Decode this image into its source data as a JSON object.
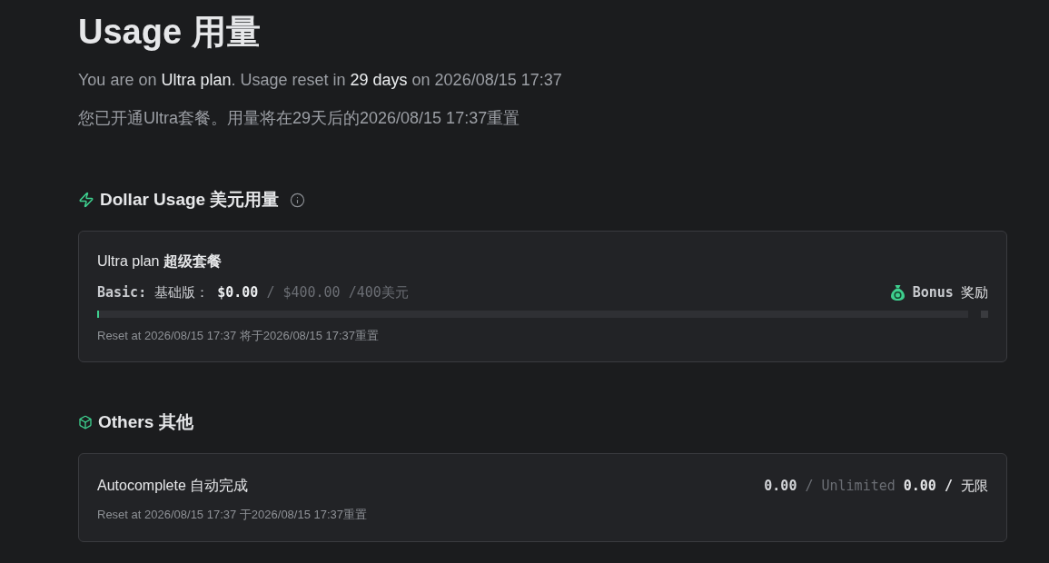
{
  "header": {
    "title": "Usage 用量",
    "summary_en": "You are on **Ultra plan**. Usage reset in **29 days** on 2026/08/15 17:37",
    "summary_zh": "您已开通Ultra套餐。用量将在29天后的2026/08/15 17:37重置"
  },
  "sections": [
    {
      "kind": "dollar",
      "title": "Dollar Usage 美元用量",
      "items": [
        {
          "kind": "plan",
          "name": "Ultra plan **超级套餐**",
          "tier": "**Basic:** 基础版：",
          "used": "$0.00",
          "limit": "/ $400.00 /400美元",
          "bonus": "**Bonus** 奖励",
          "level": 0.002,
          "reset": "Reset at 2026/08/15 17:37 将于2026/08/15 17:37重置"
        }
      ]
    },
    {
      "kind": "others",
      "title": "Others 其他",
      "items": [
        {
          "kind": "feature",
          "name": "Autocomplete 自动完成",
          "used": "0.00",
          "limit": "/ Unlimited",
          "extra": "**0.00 /** 无限",
          "reset": "Reset at 2026/08/15 17:37 于2026/08/15 17:37重置"
        }
      ]
    }
  ]
}
